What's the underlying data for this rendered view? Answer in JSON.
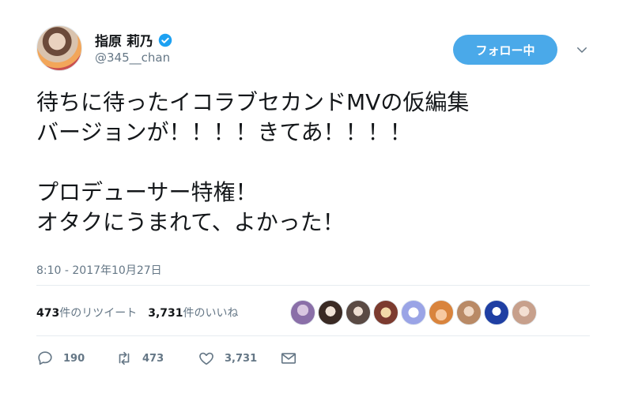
{
  "tweet": {
    "author": {
      "display_name": "指原 莉乃",
      "handle": "@345__chan"
    },
    "follow_label": "フォロー中",
    "text_lines": [
      "待ちに待ったイコラブセカンドMVの仮編集",
      "バージョンが！！！！きてあ！！！！",
      "",
      "プロデューサー特権！",
      "オタクにうまれて、よかった！"
    ],
    "timestamp": "8:10 - 2017年10月27日"
  },
  "stats": {
    "retweets_count": "473",
    "retweets_label": "件のリツイート",
    "likes_count": "3,731",
    "likes_label": "件のいいね"
  },
  "actions": {
    "reply_count": "190",
    "retweet_count": "473",
    "like_count": "3,731"
  },
  "colors": {
    "accent": "#4aa9e9",
    "muted": "#657786",
    "text": "#14171a",
    "divider": "#e6ecf0"
  },
  "icons": [
    "verified-icon",
    "chevron-down-icon",
    "reply-icon",
    "retweet-icon",
    "like-icon",
    "message-icon"
  ]
}
